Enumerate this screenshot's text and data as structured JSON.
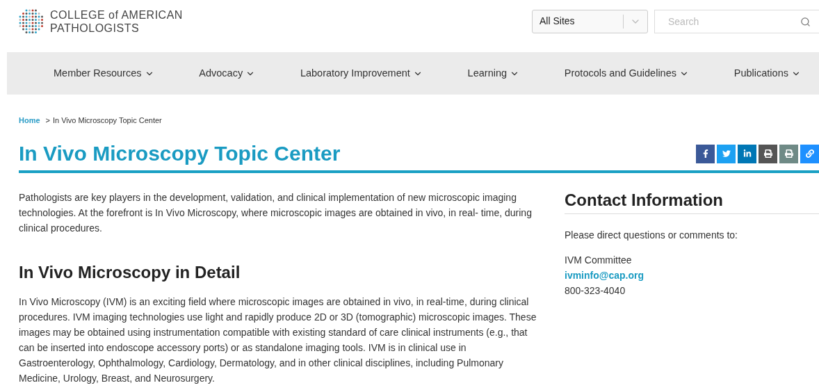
{
  "header": {
    "logo": {
      "line_1": "COLLEGE of AMERICAN",
      "line_2": "PATHOLOGISTS"
    },
    "site_select": {
      "value": "All Sites"
    },
    "search": {
      "placeholder": "Search"
    }
  },
  "nav": {
    "items": [
      {
        "label": "Member Resources"
      },
      {
        "label": "Advocacy"
      },
      {
        "label": "Laboratory Improvement"
      },
      {
        "label": "Learning"
      },
      {
        "label": "Protocols and Guidelines"
      },
      {
        "label": "Publications"
      }
    ]
  },
  "breadcrumb": {
    "home": "Home",
    "separator": ">",
    "current": "In Vivo Microscopy Topic Center"
  },
  "page_title": "In Vivo Microscopy Topic Center",
  "share_buttons": [
    {
      "kind": "facebook",
      "color": "#3b5998"
    },
    {
      "kind": "twitter",
      "color": "#1da1f2"
    },
    {
      "kind": "linkedin",
      "color": "#0077b5"
    },
    {
      "kind": "printer",
      "color": "#555555"
    },
    {
      "kind": "print",
      "color": "#6f8a86"
    },
    {
      "kind": "link",
      "color": "#1e90ff"
    }
  ],
  "main": {
    "intro": "Pathologists are key players in the development, validation, and clinical implementation of new microscopic imaging technologies. At the forefront is In Vivo Microscopy, where microscopic images are obtained in vivo, in real- time, during clinical procedures.",
    "section_heading": "In Vivo Microscopy in Detail",
    "section_text": "In Vivo Microscopy (IVM) is an exciting field where microscopic images are obtained in vivo, in real-time, during clinical procedures. IVM imaging technologies use light and rapidly produce 2D or 3D (tomographic) microscopic images. These images may be obtained using instrumentation compatible with existing standard of care clinical instruments (e.g., that can be inserted into endoscope accessory ports) or as standalone imaging tools. IVM is in clinical use in Gastroenterology, Ophthalmology, Cardiology, Dermatology, and in other clinical disciplines, including Pulmonary Medicine, Urology, Breast, and Neurosurgery."
  },
  "contact": {
    "heading": "Contact Information",
    "intro": "Please direct questions or comments to:",
    "name": "IVM Committee",
    "email": "ivminfo@cap.org",
    "phone": "800-323-4040"
  }
}
